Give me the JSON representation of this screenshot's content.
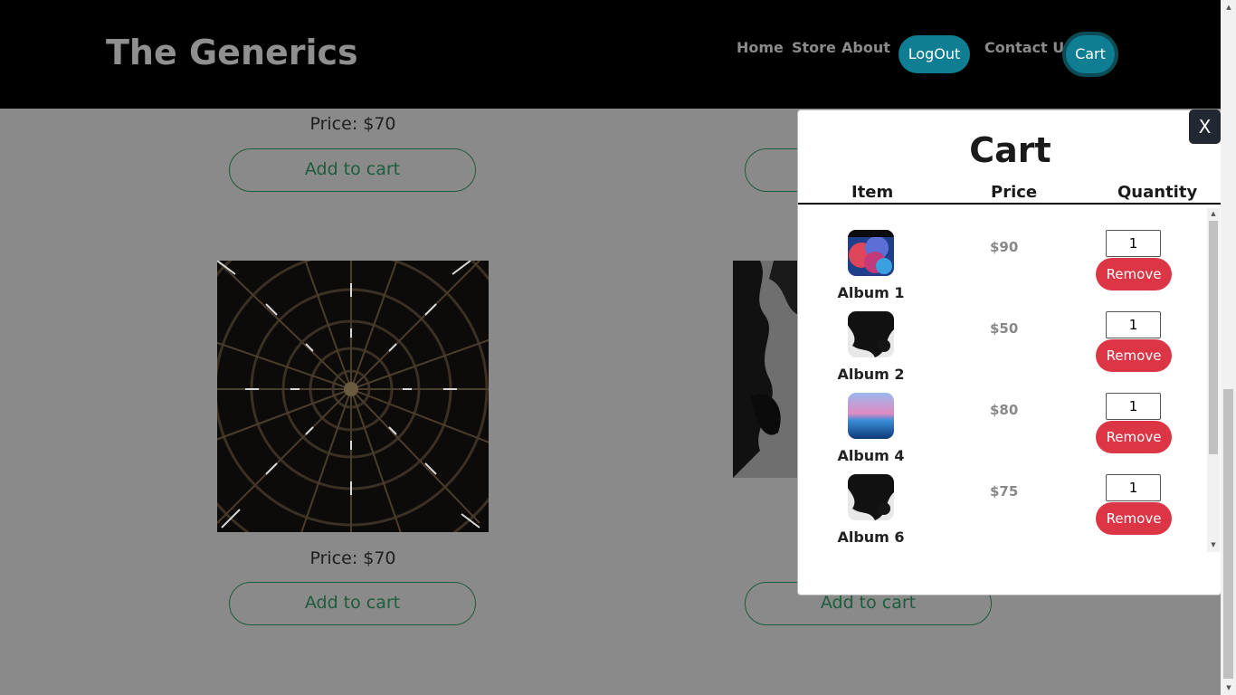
{
  "header": {
    "brand": "The Generics",
    "nav": [
      "Home",
      "Store",
      "About",
      "LogOut",
      "Contact Us",
      "Cart"
    ]
  },
  "store": {
    "price_top_left": "Price: $70",
    "price_bottom_left": "Price: $70",
    "add_to_cart": "Add to cart"
  },
  "cart": {
    "title": "Cart",
    "close": "X",
    "headers": [
      "Item",
      "Price",
      "Quantity"
    ],
    "remove_label": "Remove",
    "items": [
      {
        "name": "Album 1",
        "price": "$90",
        "qty": "1"
      },
      {
        "name": "Album 2",
        "price": "$50",
        "qty": "1"
      },
      {
        "name": "Album 4",
        "price": "$80",
        "qty": "1"
      },
      {
        "name": "Album 6",
        "price": "$75",
        "qty": "1"
      }
    ]
  },
  "colors": {
    "header_bg": "#000000",
    "accent_teal": "#0f7e92",
    "remove_red": "#dc3545",
    "overlay": "#8a8a8a"
  }
}
